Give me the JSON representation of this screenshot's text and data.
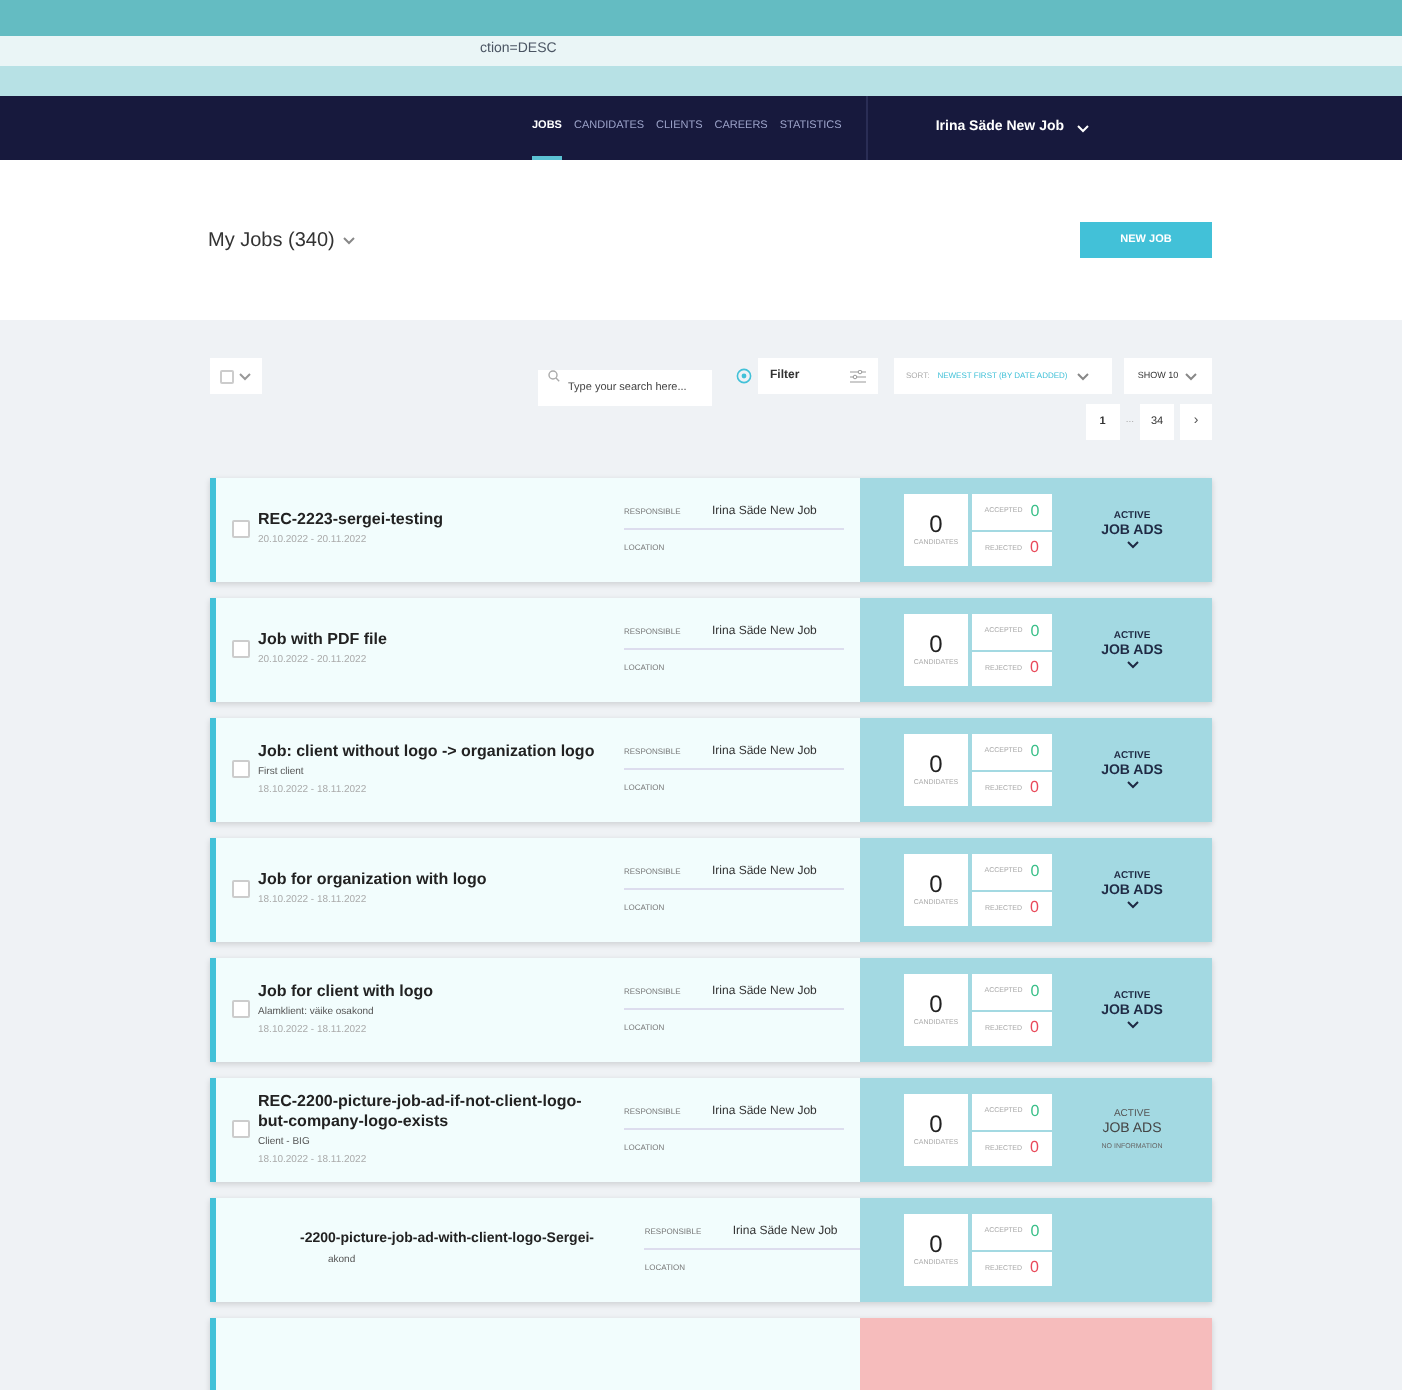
{
  "browser": {
    "url_fragment": "ction=DESC"
  },
  "nav": {
    "items": [
      {
        "label": "JOBS",
        "selected": true
      },
      {
        "label": "CANDIDATES",
        "selected": false
      },
      {
        "label": "CLIENTS",
        "selected": false
      },
      {
        "label": "CAREERS",
        "selected": false
      },
      {
        "label": "STATISTICS",
        "selected": false
      }
    ],
    "user": "Irina Säde New Job"
  },
  "header": {
    "title": "My Jobs (340)",
    "new_button": "NEW JOB"
  },
  "toolbar": {
    "search_placeholder": "Type your search here...",
    "filter": "Filter",
    "sort_label": "SORT:",
    "sort_value": "NEWEST FIRST (BY DATE ADDED)",
    "show": "SHOW 10"
  },
  "select_all": {
    "checked": false
  },
  "pagination": {
    "first": {
      "label": "1",
      "selected": true
    },
    "ellipsis": "...",
    "last": {
      "label": "34",
      "selected": false
    },
    "next": "›"
  },
  "jobs": [
    {
      "checked": false,
      "title": "REC-2223-sergei-testing",
      "dates": "20.10.2022 - 20.11.2022",
      "responsible_label": "RESPONSIBLE",
      "responsible": "Irina Säde New Job",
      "location_label": "LOCATION",
      "candidates": "0",
      "candidates_label": "CANDIDATES",
      "accepted_label": "ACCEPTED",
      "accepted": "0",
      "rejected_label": "REJECTED",
      "rejected": "0",
      "ads_top": "ACTIVE",
      "ads": "JOB ADS",
      "expandable": true,
      "color": "#a3d9e2"
    },
    {
      "checked": false,
      "title": "Job with PDF file",
      "dates": "20.10.2022 - 20.11.2022",
      "responsible_label": "RESPONSIBLE",
      "responsible": "Irina Säde New Job",
      "location_label": "LOCATION",
      "candidates": "0",
      "candidates_label": "CANDIDATES",
      "accepted_label": "ACCEPTED",
      "accepted": "0",
      "rejected_label": "REJECTED",
      "rejected": "0",
      "ads_top": "ACTIVE",
      "ads": "JOB ADS",
      "expandable": true,
      "color": "#a3d9e2"
    },
    {
      "checked": false,
      "title": "Job: client without logo -> organization logo",
      "client": "First client",
      "dates": "18.10.2022 - 18.11.2022",
      "responsible_label": "RESPONSIBLE",
      "responsible": "Irina Säde New Job",
      "location_label": "LOCATION",
      "candidates": "0",
      "candidates_label": "CANDIDATES",
      "accepted_label": "ACCEPTED",
      "accepted": "0",
      "rejected_label": "REJECTED",
      "rejected": "0",
      "ads_top": "ACTIVE",
      "ads": "JOB ADS",
      "expandable": true,
      "color": "#a3d9e2"
    },
    {
      "checked": false,
      "title": "Job for organization with logo",
      "dates": "18.10.2022 - 18.11.2022",
      "responsible_label": "RESPONSIBLE",
      "responsible": "Irina Säde New Job",
      "location_label": "LOCATION",
      "candidates": "0",
      "candidates_label": "CANDIDATES",
      "accepted_label": "ACCEPTED",
      "accepted": "0",
      "rejected_label": "REJECTED",
      "rejected": "0",
      "ads_top": "ACTIVE",
      "ads": "JOB ADS",
      "expandable": true,
      "color": "#a3d9e2"
    },
    {
      "checked": false,
      "title": "Job for client with logo",
      "client": "Alamklient: väike osakond",
      "dates": "18.10.2022 - 18.11.2022",
      "responsible_label": "RESPONSIBLE",
      "responsible": "Irina Säde New Job",
      "location_label": "LOCATION",
      "candidates": "0",
      "candidates_label": "CANDIDATES",
      "accepted_label": "ACCEPTED",
      "accepted": "0",
      "rejected_label": "REJECTED",
      "rejected": "0",
      "ads_top": "ACTIVE",
      "ads": "JOB ADS",
      "expandable": true,
      "color": "#a3d9e2"
    },
    {
      "checked": false,
      "title": "REC-2200-picture-job-ad-if-not-client-logo-but-company-logo-exists",
      "client": "Client - BIG",
      "dates": "18.10.2022 - 18.11.2022",
      "responsible_label": "RESPONSIBLE",
      "responsible": "Irina Säde New Job",
      "location_label": "LOCATION",
      "candidates": "0",
      "candidates_label": "CANDIDATES",
      "accepted_label": "ACCEPTED",
      "accepted": "0",
      "rejected_label": "REJECTED",
      "rejected": "0",
      "ads_top": "ACTIVE",
      "ads": "JOB ADS",
      "ads_note": "NO INFORMATION",
      "expandable": false,
      "color": "#a3d9e2"
    },
    {
      "title": "-2200-picture-job-ad-with-client-logo-Sergei-",
      "client": "akond",
      "responsible_label": "RESPONSIBLE",
      "responsible": "Irina Säde New Job",
      "location_label": "LOCATION",
      "candidates": "0",
      "candidates_label": "CANDIDATES",
      "accepted_label": "ACCEPTED",
      "accepted": "0",
      "rejected_label": "REJECTED",
      "rejected": "0",
      "color": "#a3d9e2"
    },
    {
      "color": "#f6bcbc"
    }
  ]
}
